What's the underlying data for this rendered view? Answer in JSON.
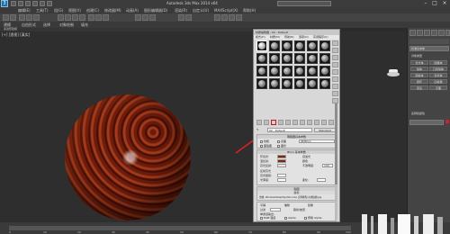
{
  "app": {
    "title": "Autodesk 3ds Max 2014 x64",
    "logo_letter": "3",
    "menus": [
      "编辑(E)",
      "工具(T)",
      "组(G)",
      "视图(V)",
      "创建(C)",
      "修改器(M)",
      "动画(A)",
      "图形编辑器(D)",
      "渲染(R)",
      "自定义(U)",
      "MAXScript(X)",
      "帮助(H)"
    ],
    "ribbon_tabs": [
      "建模",
      "自由形式",
      "选择",
      "对象绘制",
      "填充"
    ],
    "ribbon_sub": "多边形建模"
  },
  "viewport": {
    "label": "[+] [透视] [真实]",
    "sphere_material": "wood"
  },
  "material_editor": {
    "title": "材质编辑器 - 02 - Default",
    "menus": [
      "模式(D)",
      "材质(M)",
      "导航(N)",
      "选项(O)",
      "实用程序(U)"
    ],
    "slot_count": 24,
    "active_slot": 0,
    "name_field": "02 - Default",
    "type_button": "Standard",
    "rollouts": {
      "shader": {
        "header": "明暗器基本参数",
        "shader_type": "(B)Blinn",
        "options": [
          "线框",
          "双面",
          "面贴图",
          "面状"
        ]
      },
      "blinn": {
        "header": "Blinn 基本参数",
        "self_illum": "自发光",
        "color_label": "颜色",
        "ambient": "环境光:",
        "diffuse": "漫反射:",
        "specular": "高光反射:",
        "opacity": "不透明度:",
        "opacity_value": "100",
        "specular_highlights": "反射高光",
        "spec_level": "高光级别:",
        "glossiness": "光泽度:",
        "soften": "柔化:"
      },
      "maps": {
        "header": "贴图",
        "sub_header": "坐标",
        "path": "位图: Windows\\Desktop\\3ds max 实例教程\\木纹贴图.jpg",
        "tiling": "平铺",
        "offset": "偏移",
        "mirror": "镜像"
      },
      "bitmap": {
        "filter_label": "过滤",
        "crop_label": "裁剪/放置",
        "output_label": "单通道输出:",
        "rgb_label": "RGB 强度",
        "alpha_label": "Alpha",
        "premult": "预乘 Alpha"
      }
    },
    "highlighted_button": "assign-material-to-selection"
  },
  "command_panel": {
    "dropdown": "标准基本体",
    "object_type": "对象类型",
    "buttons": [
      "长方体",
      "圆锥体",
      "球体",
      "几何球体",
      "圆柱体",
      "管状体",
      "圆环",
      "四棱锥",
      "茶壶",
      "平面"
    ],
    "name_color": "名称和颜色",
    "swatch_color": "#d0202a"
  },
  "timeline": {
    "ticks": [
      "0",
      "10",
      "20",
      "30",
      "40",
      "50",
      "60",
      "70",
      "80",
      "90",
      "100"
    ]
  }
}
